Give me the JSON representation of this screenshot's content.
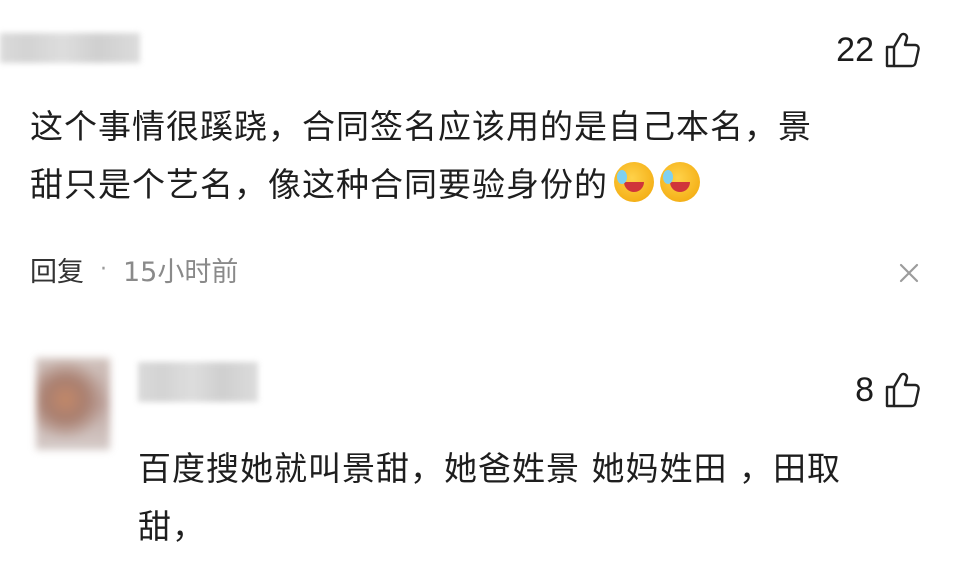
{
  "comments": [
    {
      "likes": "22",
      "text_line1": "这个事情很蹊跷，合同签名应该用的是自己本名，景",
      "text_line2": "甜只是个艺名，像这种合同要验身份的",
      "reply_label": "回复",
      "separator": "·",
      "time": "15小时前",
      "emoji": "rolling-on-floor-laughing-emoji"
    },
    {
      "likes": "8",
      "text_line1": "百度搜她就叫景甜，她爸姓景 她妈姓田 ，田取",
      "text_line2": "甜，"
    }
  ],
  "icons": {
    "like": "thumbs-up-icon",
    "close": "close-icon"
  },
  "colors": {
    "text": "#1e1e1e",
    "muted": "#8a8a8a"
  }
}
